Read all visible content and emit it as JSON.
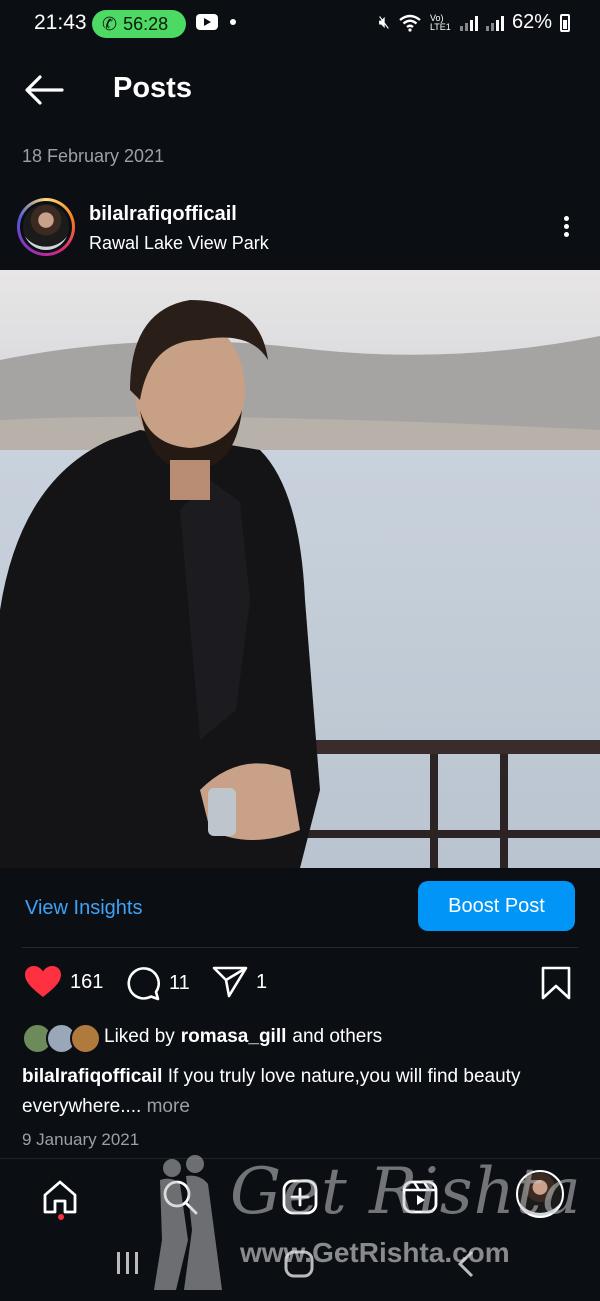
{
  "status_bar": {
    "time": "21:43",
    "call_duration": "56:28",
    "battery": "62%",
    "network_label": "Vo) LTE1"
  },
  "header": {
    "title": "Posts"
  },
  "post": {
    "date_top": "18 February 2021",
    "username": "bilalrafiqofficail",
    "location": "Rawal Lake View Park",
    "view_insights": "View Insights",
    "boost_label": "Boost Post",
    "likes": "161",
    "comments": "11",
    "shares": "1",
    "liked_by_prefix": "Liked by",
    "liked_by_user": "romasa_gill",
    "liked_by_suffix": "and others",
    "caption_user": "bilalrafiqofficail",
    "caption_text": "If you truly love nature,you will find beauty everywhere....",
    "caption_more": "more",
    "date_bottom": "9 January 2021"
  },
  "colors": {
    "background": "#0b0f14",
    "accent_link": "#3fa2f7",
    "boost_button": "#0095f6",
    "heart": "#ff3040",
    "call_pill": "#4cd964"
  },
  "icons": {
    "back": "arrow-left-icon",
    "more": "more-vertical-icon",
    "like": "heart-filled-icon",
    "comment": "comment-bubble-icon",
    "share": "paper-plane-icon",
    "save": "bookmark-icon",
    "nav_home": "home-icon",
    "nav_search": "search-icon",
    "nav_add": "add-post-icon",
    "nav_reels": "reels-icon"
  },
  "watermark": {
    "title": "Get Rishta",
    "url": "www.GetRishta.com"
  }
}
